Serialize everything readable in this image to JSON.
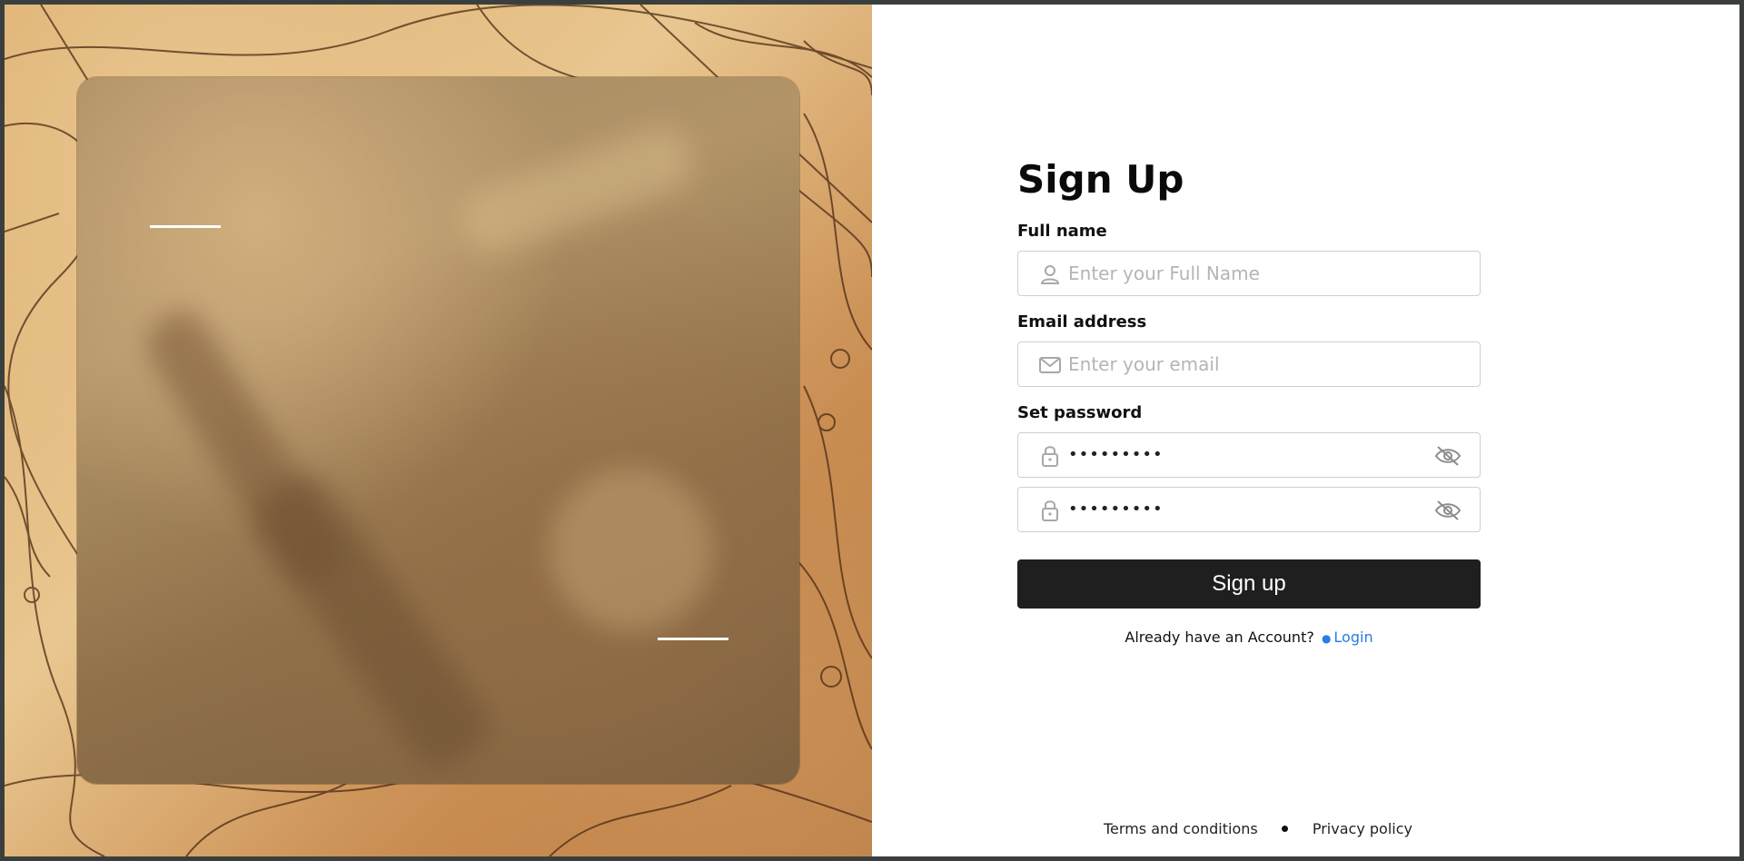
{
  "form": {
    "title": "Sign Up",
    "full_name": {
      "label": "Full name",
      "placeholder": "Enter your Full Name",
      "icon": "user-icon"
    },
    "email": {
      "label": "Email address",
      "placeholder": "Enter your email",
      "icon": "mail-icon"
    },
    "password": {
      "label": "Set password",
      "value": "•••••••••",
      "confirm_value": "•••••••••",
      "icon": "lock-icon",
      "toggle_icon": "eye-off-icon"
    },
    "submit_label": "Sign up",
    "login_prompt": "Already have an Account?",
    "login_link": "Login"
  },
  "footer": {
    "terms": "Terms and conditions",
    "privacy": "Privacy policy"
  },
  "colors": {
    "accent": "#2a7de1",
    "button": "#1f1f1f"
  }
}
